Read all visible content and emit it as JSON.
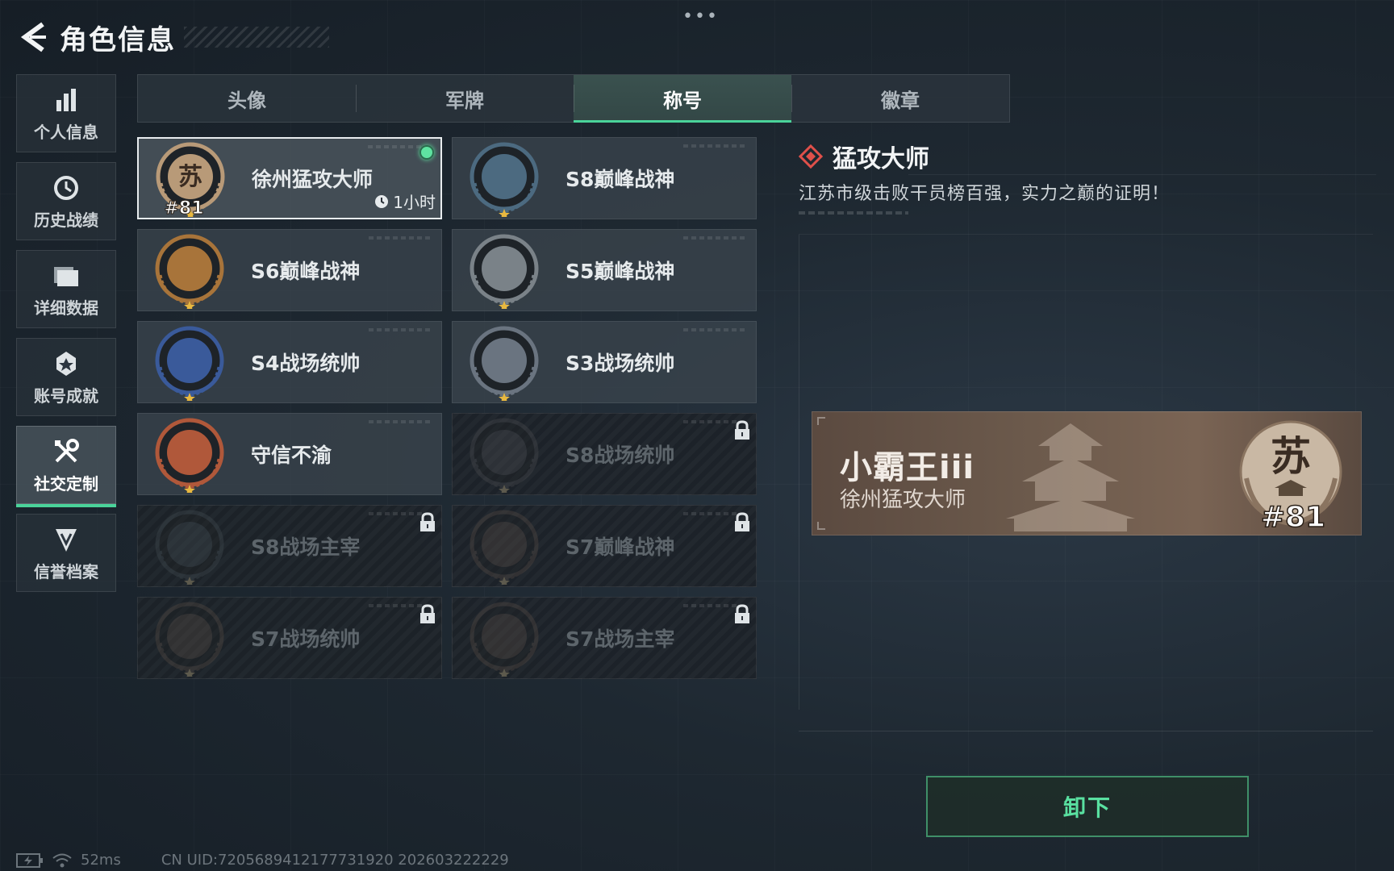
{
  "header": {
    "title": "角色信息",
    "more": "•••"
  },
  "sidebar": {
    "items": [
      {
        "label": "个人信息",
        "icon": "bar-chart-icon"
      },
      {
        "label": "历史战绩",
        "icon": "history-icon"
      },
      {
        "label": "详细数据",
        "icon": "folder-icon"
      },
      {
        "label": "账号成就",
        "icon": "achievement-icon"
      },
      {
        "label": "社交定制",
        "icon": "tools-icon",
        "active": true
      },
      {
        "label": "信誉档案",
        "icon": "shield-badge-icon"
      }
    ]
  },
  "tabs": [
    {
      "label": "头像"
    },
    {
      "label": "军牌"
    },
    {
      "label": "称号",
      "active": true
    },
    {
      "label": "徽章"
    }
  ],
  "titles": [
    {
      "name": "徐州猛攻大师",
      "emblem_text": "苏",
      "rank": "#81",
      "timer": "1小时",
      "equipped": true,
      "selected": true,
      "locked": false,
      "color": "#b89a78"
    },
    {
      "name": "S8巅峰战神",
      "locked": false,
      "color": "#4c6a80"
    },
    {
      "name": "S6巅峰战神",
      "locked": false,
      "color": "#a8743a"
    },
    {
      "name": "S5巅峰战神",
      "locked": false,
      "color": "#7a8288"
    },
    {
      "name": "S4战场统帅",
      "locked": false,
      "color": "#3a5a9a"
    },
    {
      "name": "S3战场统帅",
      "locked": false,
      "color": "#6a7480"
    },
    {
      "name": "守信不渝",
      "locked": false,
      "color": "#b0583a"
    },
    {
      "name": "S8战场统帅",
      "locked": true,
      "color": "#4a5056"
    },
    {
      "name": "S8战场主宰",
      "locked": true,
      "color": "#3a5060"
    },
    {
      "name": "S7巅峰战神",
      "locked": true,
      "color": "#6a4a3a"
    },
    {
      "name": "S7战场统帅",
      "locked": true,
      "color": "#6a4a3a"
    },
    {
      "name": "S7战场主宰",
      "locked": true,
      "color": "#6a4a3a"
    }
  ],
  "detail": {
    "name": "猛攻大师",
    "description": "江苏市级击败干员榜百强，实力之巅的证明！",
    "banner": {
      "nickname": "小霸王iii",
      "title": "徐州猛攻大师",
      "emblem_text": "苏",
      "rank": "#81"
    },
    "unequip_label": "卸下"
  },
  "status": {
    "ping": "52ms",
    "uid": "CN UID:7205689412177731920 202603222229"
  },
  "colors": {
    "accent": "#4ad39a",
    "diamond": "#e0504a"
  }
}
